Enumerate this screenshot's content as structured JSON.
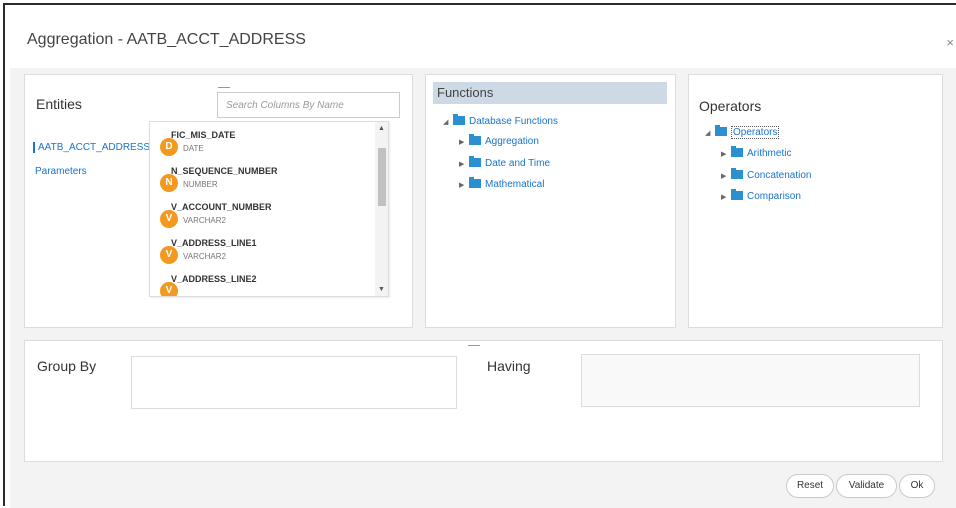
{
  "dialog": {
    "title": "Aggregation - AATB_ACCT_ADDRESS",
    "close_label": "×"
  },
  "entities": {
    "heading": "Entities",
    "search_placeholder": "Search Columns By Name",
    "items": [
      "AATB_ACCT_ADDRESS",
      "Parameters"
    ],
    "selected": "AATB_ACCT_ADDRESS",
    "columns": [
      {
        "badge": "D",
        "name": "FIC_MIS_DATE",
        "type": "DATE"
      },
      {
        "badge": "N",
        "name": "N_SEQUENCE_NUMBER",
        "type": "NUMBER"
      },
      {
        "badge": "V",
        "name": "V_ACCOUNT_NUMBER",
        "type": "VARCHAR2"
      },
      {
        "badge": "V",
        "name": "V_ADDRESS_LINE1",
        "type": "VARCHAR2"
      },
      {
        "badge": "V",
        "name": "V_ADDRESS_LINE2",
        "type": ""
      }
    ]
  },
  "functions": {
    "heading": "Functions",
    "root": "Database Functions",
    "children": [
      "Aggregation",
      "Date and Time",
      "Mathematical"
    ]
  },
  "operators": {
    "heading": "Operators",
    "root": "Operators",
    "children": [
      "Arithmetic",
      "Concatenation",
      "Comparison"
    ]
  },
  "group_by": {
    "label": "Group By"
  },
  "having": {
    "label": "Having"
  },
  "buttons": {
    "reset": "Reset",
    "validate": "Validate",
    "ok": "Ok"
  },
  "colors": {
    "accent": "#1a73c8",
    "badge": "#f39a1e",
    "folder": "#2b8fd0",
    "header": "#cdd9e5"
  },
  "icons": [
    "folder-icon",
    "tree-expand-icon",
    "tree-collapse-icon",
    "scroll-up-icon",
    "scroll-down-icon",
    "close-icon"
  ]
}
